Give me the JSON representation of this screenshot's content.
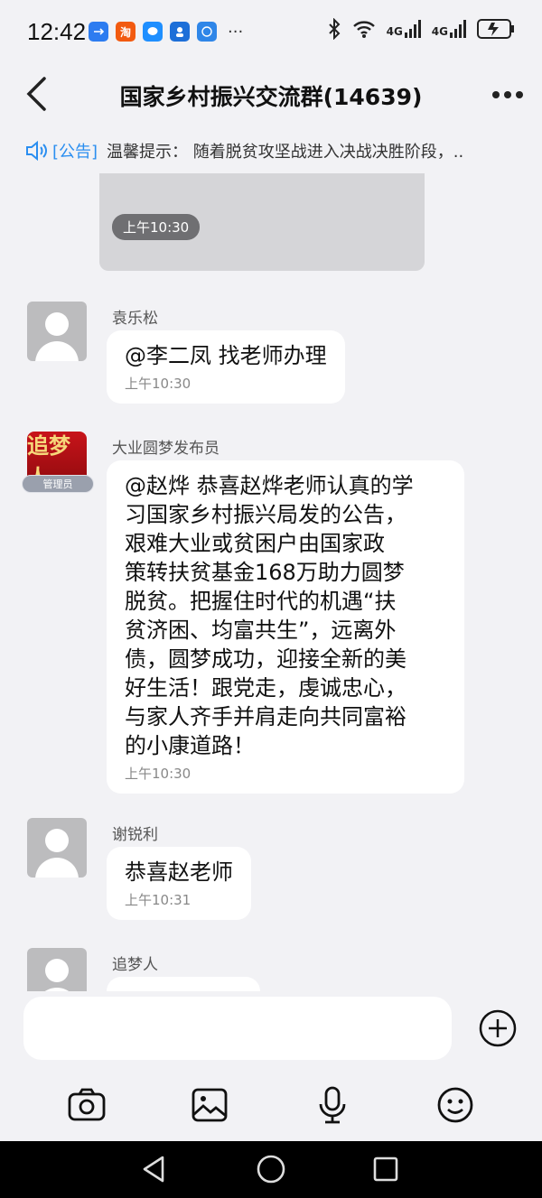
{
  "status": {
    "time": "12:42",
    "apps": [
      "usb-icon",
      "taobao-icon",
      "message-icon",
      "contacts-icon",
      "compass-icon"
    ],
    "more": "···",
    "net1": "4G",
    "net2": "4G"
  },
  "nav": {
    "title": "国家乡村振兴交流群(14639)"
  },
  "notice": {
    "tag": "[公告]",
    "text": "温馨提示：  随着脱贫攻坚战进入决战决胜阶段，.."
  },
  "image_message": {
    "time": "上午10:30"
  },
  "messages": [
    {
      "sender": "袁乐松",
      "text": "@李二凤 找老师办理",
      "time": "上午10:30"
    },
    {
      "sender": "大业圆梦发布员",
      "badge": "管理员",
      "avatar_text": "追梦人",
      "text": "@赵烨 恭喜赵烨老师认真的学\n习国家乡村振兴局发的公告，\n艰难大业或贫困户由国家政\n策转扶贫基金168万助力圆梦\n脱贫。把握住时代的机遇“扶\n贫济困、均富共生”，远离外\n债，圆梦成功，迎接全新的美\n好生活！跟党走，虔诚忠心，\n与家人齐手并肩走向共同富裕\n的小康道路！",
      "time": "上午10:30"
    },
    {
      "sender": "谢锐利",
      "text": "恭喜赵老师",
      "time": "上午10:31"
    },
    {
      "sender": "追梦人"
    }
  ],
  "colors": {
    "background": "#f2f2f5",
    "accent": "#2a8ef0",
    "bubble": "#ffffff",
    "admin_avatar": "#c8141a"
  }
}
